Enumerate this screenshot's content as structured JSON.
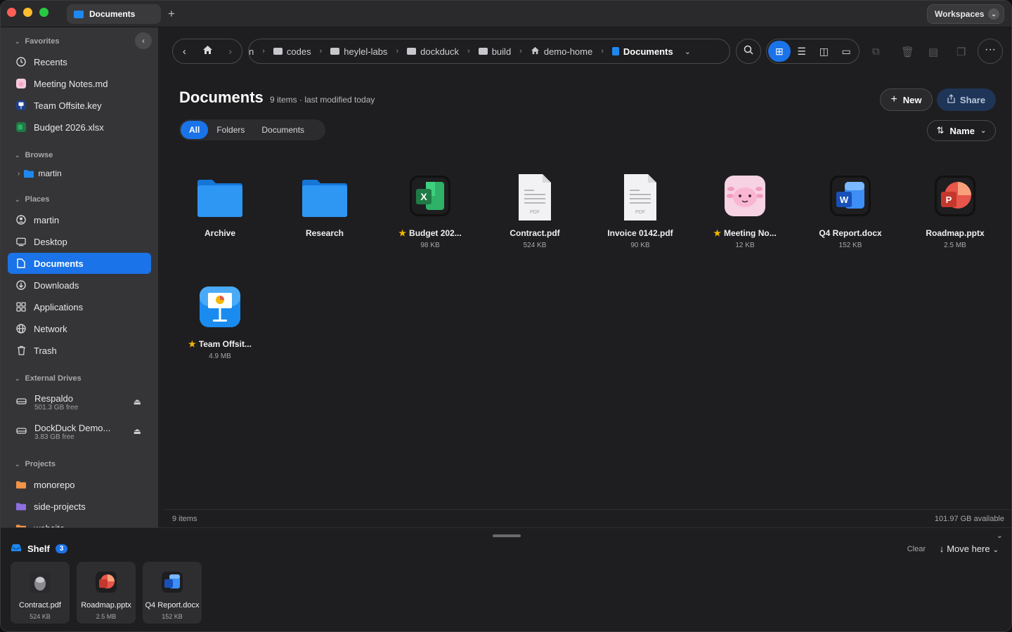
{
  "titlebar": {
    "tab_label": "Documents",
    "new_tab": "+",
    "workspaces_label": "Workspaces"
  },
  "sidebar": {
    "favorites_header": "Favorites",
    "favorites": [
      {
        "label": "Recents",
        "icon": "clock-icon"
      },
      {
        "label": "Meeting Notes.md",
        "icon": "axolotl-app-icon"
      },
      {
        "label": "Team Offsite.key",
        "icon": "keynote-icon"
      },
      {
        "label": "Budget 2026.xlsx",
        "icon": "excel-icon"
      }
    ],
    "browse_header": "Browse",
    "browse": [
      {
        "label": "martin",
        "icon": "folder-icon"
      }
    ],
    "places_header": "Places",
    "places": [
      {
        "label": "martin",
        "icon": "user-icon"
      },
      {
        "label": "Desktop",
        "icon": "desktop-icon"
      },
      {
        "label": "Documents",
        "icon": "document-icon",
        "selected": true
      },
      {
        "label": "Downloads",
        "icon": "download-icon"
      },
      {
        "label": "Applications",
        "icon": "apps-grid-icon"
      },
      {
        "label": "Network",
        "icon": "globe-icon"
      },
      {
        "label": "Trash",
        "icon": "trash-icon"
      }
    ],
    "drives_header": "External Drives",
    "drives": [
      {
        "label": "Respaldo",
        "free": "501.3 GB free"
      },
      {
        "label": "DockDuck Demo...",
        "free": "3.83 GB free"
      }
    ],
    "projects_header": "Projects",
    "projects": [
      {
        "label": "monorepo",
        "color": "#f0954a"
      },
      {
        "label": "side-projects",
        "color": "#8e6fe0"
      },
      {
        "label": "website",
        "color": "#f0954a"
      }
    ]
  },
  "breadcrumbs": {
    "items": [
      "n",
      "codes",
      "heylel-labs",
      "dockduck",
      "build",
      "demo-home",
      "Documents"
    ]
  },
  "header": {
    "title": "Documents",
    "meta": "9 items · last modified today",
    "new_label": "New",
    "share_label": "Share",
    "sort_label": "Name"
  },
  "filters": [
    "All",
    "Folders",
    "Documents"
  ],
  "files": [
    {
      "name": "Archive",
      "size": "",
      "starred": false,
      "kind": "folder"
    },
    {
      "name": "Research",
      "size": "",
      "starred": false,
      "kind": "folder"
    },
    {
      "name": "Budget 202...",
      "size": "98 KB",
      "starred": true,
      "kind": "excel"
    },
    {
      "name": "Contract.pdf",
      "size": "524 KB",
      "starred": false,
      "kind": "pdf"
    },
    {
      "name": "Invoice 0142.pdf",
      "size": "90 KB",
      "starred": false,
      "kind": "pdf"
    },
    {
      "name": "Meeting No...",
      "size": "12 KB",
      "starred": true,
      "kind": "axolotl"
    },
    {
      "name": "Q4 Report.docx",
      "size": "152 KB",
      "starred": false,
      "kind": "word"
    },
    {
      "name": "Roadmap.pptx",
      "size": "2.5 MB",
      "starred": false,
      "kind": "powerpoint"
    },
    {
      "name": "Team Offsit...",
      "size": "4.9 MB",
      "starred": true,
      "kind": "keynote"
    }
  ],
  "status": {
    "count": "9 items",
    "available": "101.97 GB available"
  },
  "shelf": {
    "title": "Shelf",
    "badge": "3",
    "clear": "Clear",
    "move_here": "Move here",
    "items": [
      {
        "name": "Contract.pdf",
        "size": "524 KB",
        "kind": "preview"
      },
      {
        "name": "Roadmap.pptx",
        "size": "2.5 MB",
        "kind": "powerpoint"
      },
      {
        "name": "Q4 Report.docx",
        "size": "152 KB",
        "kind": "word"
      }
    ]
  },
  "colors": {
    "accent": "#1a73e8",
    "folder": "#1e88f0",
    "star": "#f5b800"
  }
}
